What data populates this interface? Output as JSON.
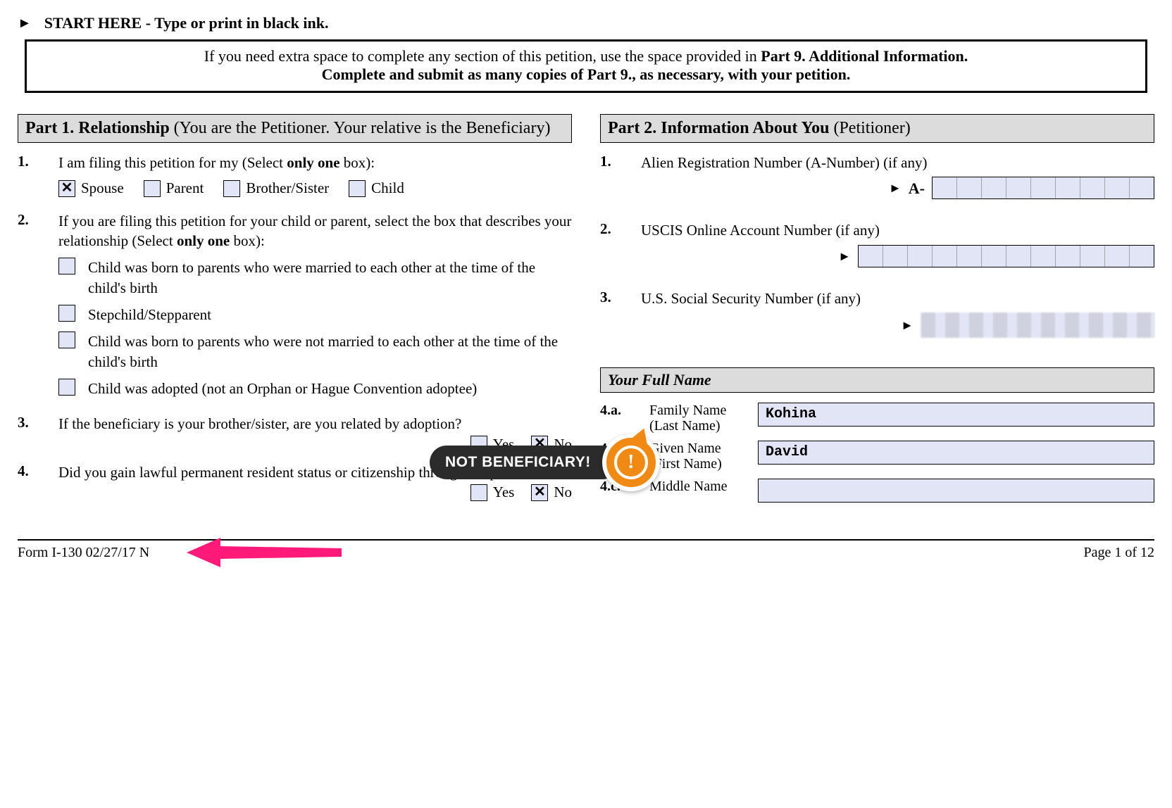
{
  "header": {
    "start_text": "START HERE - Type or print in black ink.",
    "info_prefix": "If you need extra space to complete any section of this petition, use the space provided in ",
    "info_bold1": "Part 9. Additional Information.",
    "info_line2_prefix": "Complete and submit as many copies of Part 9., as necessary, with your petition."
  },
  "part1": {
    "title_bold": "Part 1.  Relationship",
    "title_rest": " (You are the Petitioner.  Your relative is the Beneficiary)",
    "q1": {
      "num": "1.",
      "text_pre": "I am filing this petition for my (Select ",
      "only": "only one",
      "text_post": " box):",
      "opts": {
        "spouse": "Spouse",
        "parent": "Parent",
        "brosis": "Brother/Sister",
        "child": "Child"
      },
      "checked": "spouse"
    },
    "q2": {
      "num": "2.",
      "text_pre": "If you are filing this petition for your child or parent, select the box that describes your relationship (Select ",
      "only": "only one",
      "text_post": " box):",
      "opt_a": "Child was born to parents who were married to each other at the time of the child's birth",
      "opt_b": "Stepchild/Stepparent",
      "opt_c": "Child was born to parents who were not married to each other at the time of the child's birth",
      "opt_d": "Child was adopted (not an Orphan or Hague Convention adoptee)"
    },
    "q3": {
      "num": "3.",
      "text": "If the beneficiary is your brother/sister, are you related by adoption?",
      "yes": "Yes",
      "no": "No",
      "answer": "no"
    },
    "q4": {
      "num": "4.",
      "text": "Did you gain lawful permanent resident status or citizenship through adoption?",
      "yes": "Yes",
      "no": "No",
      "answer": "no"
    }
  },
  "part2": {
    "title_bold": "Part 2.  Information About You",
    "title_rest": " (Petitioner)",
    "q1": {
      "num": "1.",
      "text": "Alien Registration Number (A-Number) (if any)",
      "prefix": "A-"
    },
    "q2": {
      "num": "2.",
      "text": "USCIS Online Account Number (if any)"
    },
    "q3": {
      "num": "3.",
      "text": "U.S. Social Security Number (if any)"
    },
    "fullname_header": "Your Full Name",
    "r4a": {
      "num": "4.a.",
      "label": "Family Name",
      "sub": "(Last Name)",
      "value": "Kohina"
    },
    "r4b": {
      "num": "4.b.",
      "label": "Given Name",
      "sub": "(First Name)",
      "value": "David"
    },
    "r4c": {
      "num": "4.c.",
      "label": "Middle Name",
      "value": ""
    }
  },
  "callout": {
    "text": "NOT BENEFICIARY!",
    "badge": "!"
  },
  "footer": {
    "left": "Form I-130   02/27/17   N",
    "right": "Page 1 of 12"
  },
  "arrow_color": "#ff1a7a"
}
